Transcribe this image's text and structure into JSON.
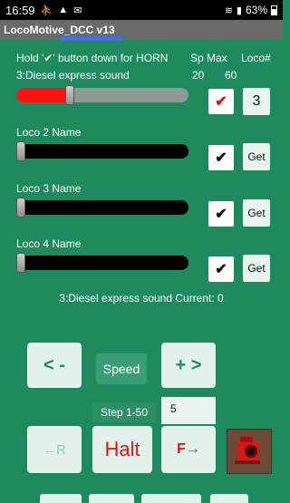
{
  "status_bar": {
    "time": "16:59",
    "battery": "63%"
  },
  "app": {
    "title": "LocoMotive_DCC v13"
  },
  "header": {
    "hint": "Hold '✔' button down for HORN",
    "sp_max": "Sp Max",
    "loco_num": "Loco#"
  },
  "loco1": {
    "name": "3:Diesel express sound",
    "sp_max_a": "20",
    "sp_max_b": "60",
    "check": "✔",
    "number": "3",
    "level": 0.3
  },
  "loco2": {
    "name": "Loco 2 Name",
    "check": "✔",
    "get": "Get",
    "level": 0
  },
  "loco3": {
    "name": "Loco 3 Name",
    "check": "✔",
    "get": "Get",
    "level": 0
  },
  "loco4": {
    "name": "Loco 4 Name",
    "check": "✔",
    "get": "Get",
    "level": 0
  },
  "status": {
    "line": "3:Diesel express sound  Current: 0"
  },
  "controls": {
    "minus": "< -",
    "speed": "Speed",
    "plus": "+ >",
    "step_label": "Step 1-50",
    "step_value": "5",
    "reverse": "←R",
    "halt": "Halt",
    "forward": "F→"
  },
  "colors": {
    "background": "#1f8a5e",
    "accent_red": "#ff1111",
    "panel": "#e2f1ec"
  }
}
